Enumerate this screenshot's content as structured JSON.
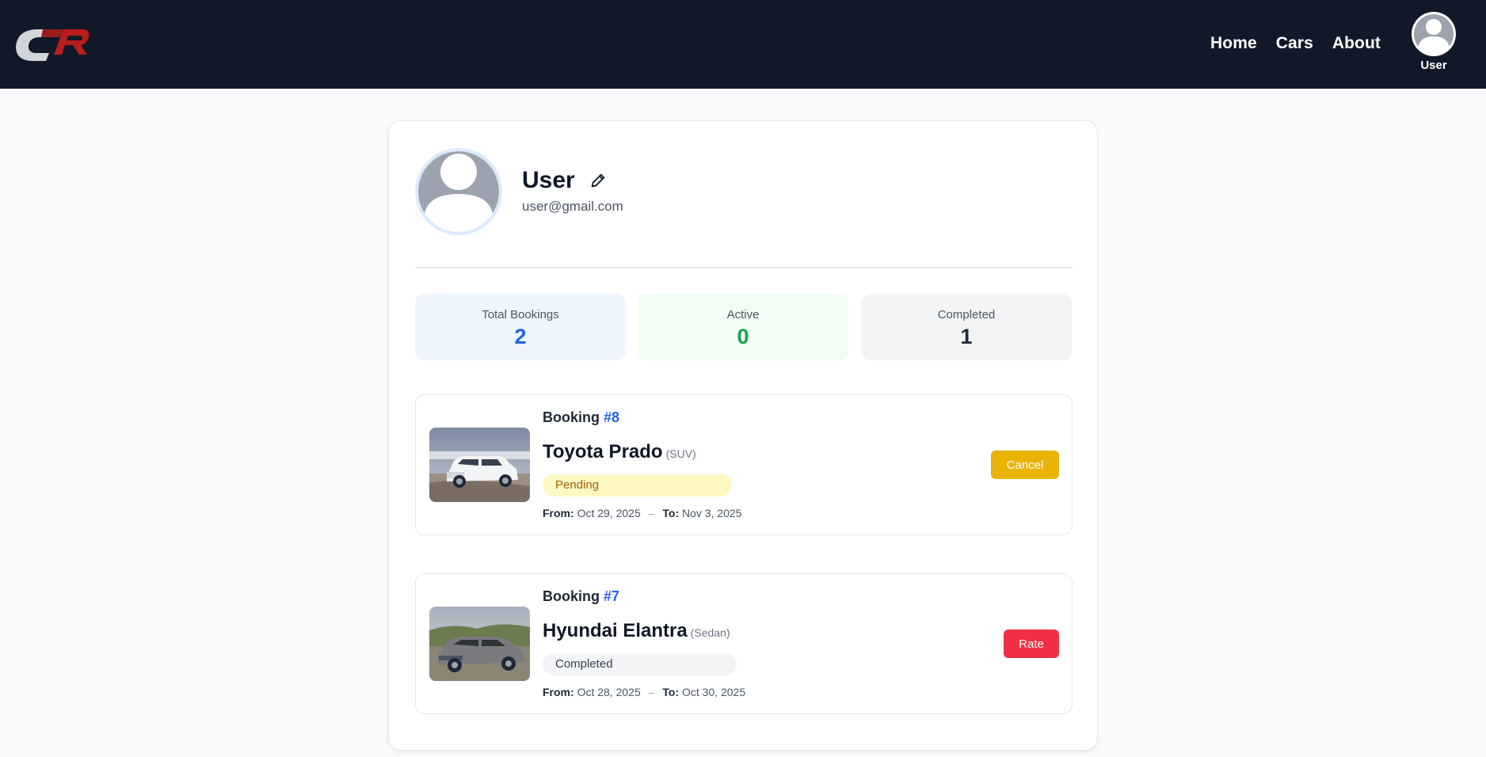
{
  "nav": {
    "logo_icon": "cr-logo",
    "links": [
      {
        "label": "Home"
      },
      {
        "label": "Cars"
      },
      {
        "label": "About"
      }
    ],
    "user_label": "User"
  },
  "profile": {
    "name": "User",
    "email": "user@gmail.com",
    "edit_icon": "pencil-icon"
  },
  "stats": {
    "total": {
      "label": "Total Bookings",
      "value": "2"
    },
    "active": {
      "label": "Active",
      "value": "0"
    },
    "completed": {
      "label": "Completed",
      "value": "1"
    }
  },
  "bookings": [
    {
      "label": "Booking",
      "number": "#8",
      "car": "Toyota Prado",
      "type": "(SUV)",
      "status": "Pending",
      "from_label": "From:",
      "from": "Oct 29, 2025",
      "separator": "–",
      "to_label": "To:",
      "to": "Nov 3, 2025",
      "action": "Cancel"
    },
    {
      "label": "Booking",
      "number": "#7",
      "car": "Hyundai Elantra",
      "type": "(Sedan)",
      "status": "Completed",
      "from_label": "From:",
      "from": "Oct 28, 2025",
      "separator": "–",
      "to_label": "To:",
      "to": "Oct 30, 2025",
      "action": "Rate"
    }
  ],
  "colors": {
    "navbar": "#111827",
    "accent_blue": "#2563eb",
    "active_green": "#16a34a",
    "cancel_yellow": "#eab308",
    "rate_red": "#f03042"
  }
}
